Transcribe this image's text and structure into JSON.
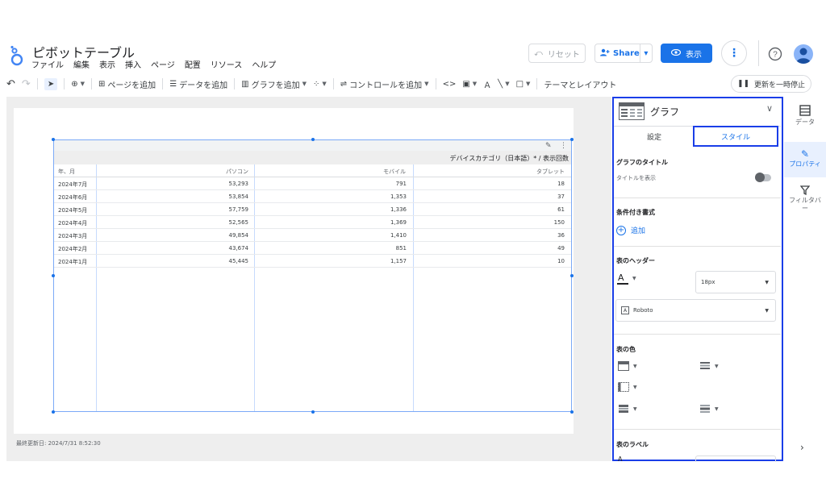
{
  "header": {
    "title": "ピボットテーブル",
    "menu": [
      "ファイル",
      "編集",
      "表示",
      "挿入",
      "ページ",
      "配置",
      "リソース",
      "ヘルプ"
    ],
    "reset_label": "リセット",
    "share_label": "Share",
    "view_label": "表示"
  },
  "toolbar": {
    "add_page": "ページを追加",
    "add_data": "データを追加",
    "add_chart": "グラフを追加",
    "add_control": "コントロールを追加",
    "theme_layout": "テーマとレイアウト",
    "pause_updates": "更新を一時停止"
  },
  "canvas": {
    "last_updated": "最終更新日: 2024/7/31 8:52:30"
  },
  "pivot_table": {
    "dimension_title": "デバイスカテゴリ（日本語）* / 表示回数",
    "row_header": "年、月",
    "column_headers": [
      "パソコン",
      "モバイル",
      "タブレット"
    ],
    "rows": [
      {
        "month": "2024年7月",
        "values": [
          "53,293",
          "791",
          "18"
        ]
      },
      {
        "month": "2024年6月",
        "values": [
          "53,854",
          "1,353",
          "37"
        ]
      },
      {
        "month": "2024年5月",
        "values": [
          "57,759",
          "1,336",
          "61"
        ]
      },
      {
        "month": "2024年4月",
        "values": [
          "52,565",
          "1,369",
          "150"
        ]
      },
      {
        "month": "2024年3月",
        "values": [
          "49,854",
          "1,410",
          "36"
        ]
      },
      {
        "month": "2024年2月",
        "values": [
          "43,674",
          "851",
          "49"
        ]
      },
      {
        "month": "2024年1月",
        "values": [
          "45,445",
          "1,157",
          "10"
        ]
      }
    ]
  },
  "properties": {
    "chart_type": "グラフ",
    "tabs": [
      "設定",
      "スタイル"
    ],
    "active_tab": "スタイル",
    "sections": {
      "chart_title": "グラフのタイトル",
      "show_title": "タイトルを表示",
      "show_title_enabled": false,
      "conditional_format": "条件付き書式",
      "add_label": "追加",
      "table_header": "表のヘッダー",
      "header_font_size": "18px",
      "header_font_family": "Roboto",
      "table_colors": "表の色",
      "table_labels": "表のラベル"
    }
  },
  "rail": {
    "data": "データ",
    "properties": "プロパティ",
    "filter": "フィルタバー"
  },
  "colors": {
    "accent": "#1a73e8",
    "highlight_border": "#1a3ee8"
  }
}
